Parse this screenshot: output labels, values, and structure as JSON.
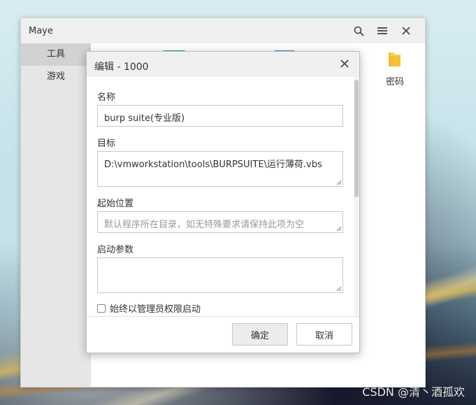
{
  "main_window": {
    "title": "Maye",
    "sidebar": {
      "items": [
        {
          "label": "工具",
          "active": true
        },
        {
          "label": "游戏",
          "active": false
        }
      ]
    },
    "content_items": [
      {
        "label": "密码",
        "icon": "folder-icon"
      }
    ]
  },
  "dialog": {
    "title": "编辑 - 1000",
    "fields": {
      "name": {
        "label": "名称",
        "value": "burp suite(专业版)"
      },
      "target": {
        "label": "目标",
        "value": "D:\\vmworkstation\\tools\\BURPSUITE\\运行薄荷.vbs"
      },
      "start_dir": {
        "label": "起始位置",
        "placeholder": "默认程序所在目录，如无特殊要求请保持此项为空"
      },
      "args": {
        "label": "启动参数",
        "value": ""
      }
    },
    "admin_checkbox": {
      "label": "始终以管理员权限启动",
      "checked": false
    },
    "buttons": {
      "ok": "确定",
      "cancel": "取消"
    }
  },
  "watermark": "CSDN @清丶酒孤欢",
  "colors": {
    "folder": "#f2c230",
    "titlebar_bg": "#f0f0f0",
    "sidebar_bg": "#e6e6e6"
  }
}
